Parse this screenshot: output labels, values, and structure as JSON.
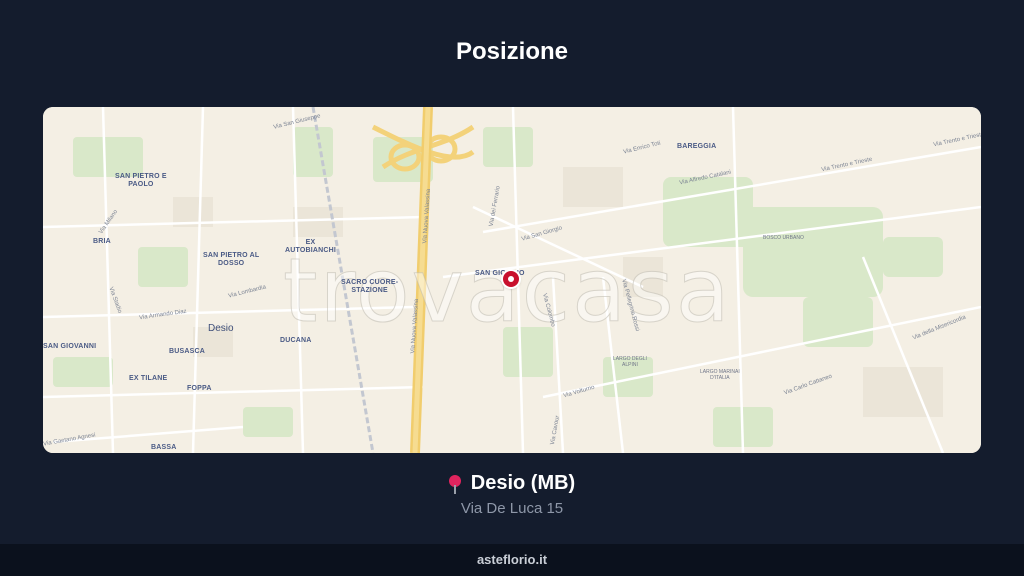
{
  "page": {
    "title": "Posizione",
    "location_name": "Desio (MB)",
    "address": "Via De Luca 15",
    "footer": "asteflorio.it",
    "location_icon": "map-pin"
  },
  "map": {
    "watermark": "trovacasa",
    "marker_icon": "map-marker",
    "labels": {
      "san_pietro_paolo": "SAN PIETRO E\nPAOLO",
      "bria": "BRIA",
      "san_pietro_dosso": "SAN PIETRO AL\nDOSSO",
      "ex_autobianchi": "EX\nAUTOBIANCHI",
      "sacro_cuore": "SACRO CUORE-\nSTAZIONE",
      "san_giorgio": "SAN GIORGIO",
      "bareggia": "BAREGGIA",
      "bosco_urbano": "BOSCO URBANO",
      "desio": "Desio",
      "busasca": "BUSASCA",
      "ducana": "DUCANA",
      "san_giovanni": "SAN GIOVANNI",
      "ex_tilane": "EX TILANE",
      "foppa": "FOPPA",
      "bassa": "BASSA",
      "largo_alpini": "LARGO DEGLI\nALPINI",
      "largo_marinai": "LARGO MARINAI\nD'ITALIA",
      "via_san_giuseppe": "Via San Giuseppe",
      "via_milano": "Via Milano",
      "via_lombardia": "Via Lombardia",
      "via_armando_diaz": "Via Armando Diaz",
      "via_nuova_valassina_1": "Via Nuova Valassina",
      "via_nuova_valassina_2": "Via Nuova Valassina",
      "via_ferrario": "Via dei Ferrario",
      "via_san_giorgio": "Via San Giorgio",
      "via_enrico_toti": "Via Enrico Toti",
      "via_alfredo_catalani": "Via Alfredo Catalani",
      "via_trento_trieste": "Via Trento e Trieste",
      "via_trento_trieste_2": "Via Trento e Trieste",
      "via_della_misericordia": "Via della Misericordia",
      "via_carlo_cattaneo": "Via Carlo Cattaneo",
      "via_pellegrino_rossi": "Via Pellegrino Rossi",
      "via_gaetano_agnesi": "Via Gaetano Agnesi",
      "via_volturno": "Via Volturno",
      "via_colombo": "Via Colombo",
      "via_cavour": "Via Cavour",
      "via_stadio": "Via Stadio"
    }
  }
}
